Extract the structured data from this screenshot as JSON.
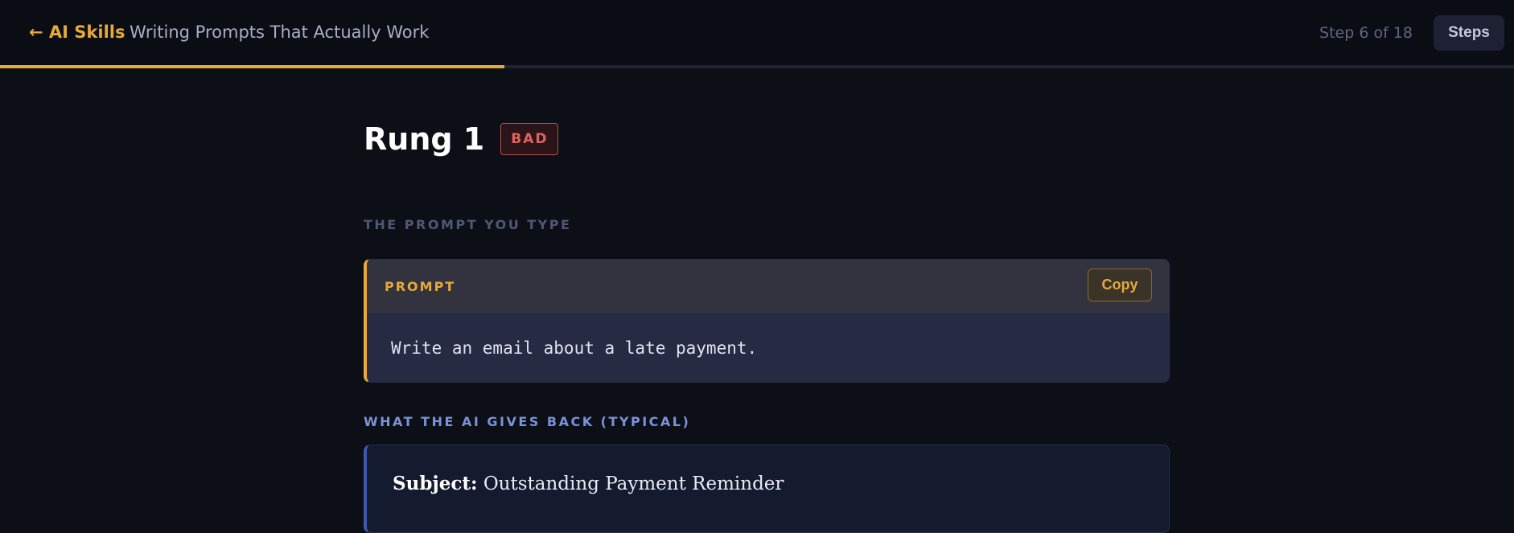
{
  "header": {
    "back_label": "← AI Skills",
    "course_title": "Writing Prompts That Actually Work",
    "step_text": "Step 6 of 18",
    "steps_button": "Steps"
  },
  "progress": {
    "current_step": 6,
    "total_steps": 18,
    "fraction": 0.333,
    "color": "#e6a93a"
  },
  "rung": {
    "title": "Rung 1",
    "badge": "BAD",
    "badge_color": "#e0625c"
  },
  "prompt_section": {
    "label": "THE PROMPT YOU TYPE",
    "card_tag": "PROMPT",
    "copy_label": "Copy",
    "text": "Write an email about a late payment."
  },
  "response_section": {
    "label": "WHAT THE AI GIVES BACK (TYPICAL)",
    "subject_label": "Subject:",
    "subject_value": "Outstanding Payment Reminder"
  },
  "colors": {
    "accent": "#e6a93a",
    "background": "#0d0f17",
    "response_accent": "#3b5aa8"
  }
}
